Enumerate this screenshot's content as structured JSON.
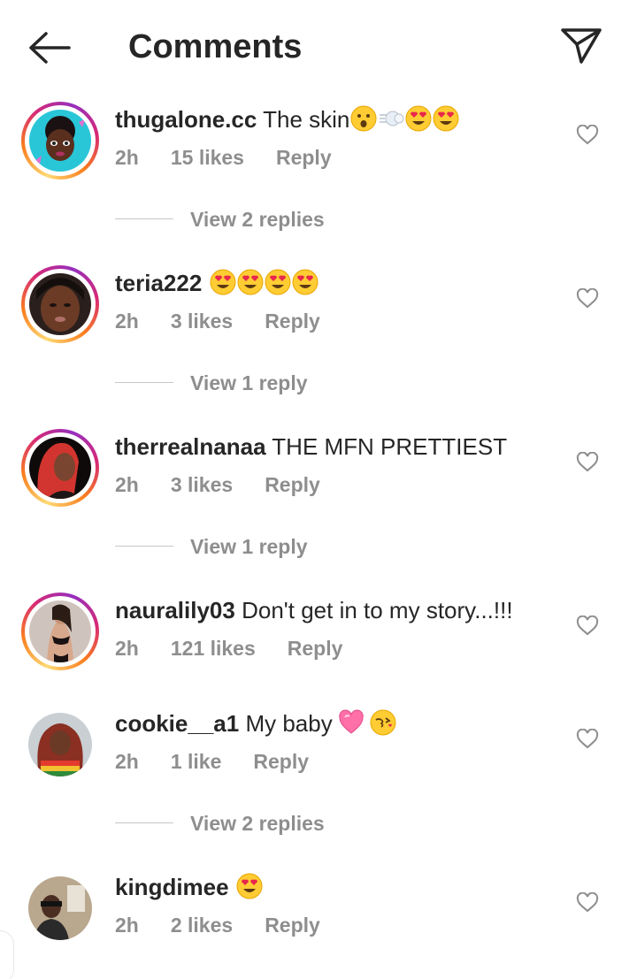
{
  "header": {
    "title": "Comments",
    "back_icon": "arrow-left-icon",
    "share_icon": "paper-plane-icon"
  },
  "colors": {
    "text": "#262626",
    "secondary": "#8e8e8e",
    "divider": "#c7c7c7",
    "story_ring": [
      "#feda75",
      "#fa7e1e",
      "#d62976",
      "#962fbf"
    ]
  },
  "comments": [
    {
      "username": "thugalone.cc",
      "text": "The skin",
      "emojis": [
        "hushed-face-emoji",
        "dash-emoji",
        "heart-eyes-emoji",
        "heart-eyes-emoji"
      ],
      "time": "2h",
      "likes": "15 likes",
      "reply": "Reply",
      "view_replies": "View 2 replies",
      "has_story": true
    },
    {
      "username": "teria222",
      "text": "",
      "emojis": [
        "heart-eyes-emoji",
        "heart-eyes-emoji",
        "heart-eyes-emoji",
        "heart-eyes-emoji"
      ],
      "time": "2h",
      "likes": "3 likes",
      "reply": "Reply",
      "view_replies": "View 1 reply",
      "has_story": true
    },
    {
      "username": "therrealnanaa",
      "text": "THE MFN PRETTIEST",
      "emojis": [],
      "time": "2h",
      "likes": "3 likes",
      "reply": "Reply",
      "view_replies": "View 1 reply",
      "has_story": true
    },
    {
      "username": "nauralily03",
      "text": "Don't get in to my story...!!!",
      "emojis": [],
      "time": "2h",
      "likes": "121 likes",
      "reply": "Reply",
      "view_replies": "",
      "has_story": true
    },
    {
      "username": "cookie__a1",
      "text": "My baby",
      "emojis": [
        "pink-heart-emoji",
        "kissing-face-emoji"
      ],
      "time": "2h",
      "likes": "1 like",
      "reply": "Reply",
      "view_replies": "View 2 replies",
      "has_story": false
    },
    {
      "username": "kingdimee",
      "text": "",
      "emojis": [
        "heart-eyes-emoji"
      ],
      "time": "2h",
      "likes": "2 likes",
      "reply": "Reply",
      "view_replies": "",
      "has_story": false
    }
  ]
}
